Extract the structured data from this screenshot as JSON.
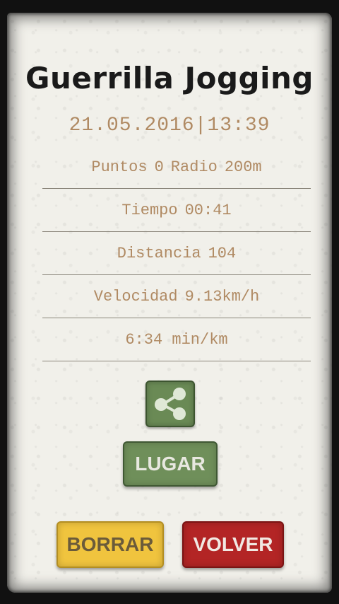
{
  "app": {
    "title": "Guerrilla Jogging"
  },
  "session": {
    "datetime": "21.05.2016|13:39",
    "points_label": "Puntos",
    "points_value": "0",
    "radius_label": "Radio",
    "radius_value": "200m",
    "time_label": "Tiempo",
    "time_value": "00:41",
    "distance_label": "Distancia",
    "distance_value": "104",
    "speed_label": "Velocidad",
    "speed_value": "9.13km/h",
    "pace_value": "6:34 min/km"
  },
  "actions": {
    "share_icon": "share-icon",
    "lugar_label": "LUGAR",
    "borrar_label": "BORRAR",
    "volver_label": "VOLVER"
  },
  "colors": {
    "accent_green": "#6f8f5a",
    "accent_yellow": "#f0c43e",
    "accent_red": "#b32525",
    "text_brown": "#b08a63"
  }
}
